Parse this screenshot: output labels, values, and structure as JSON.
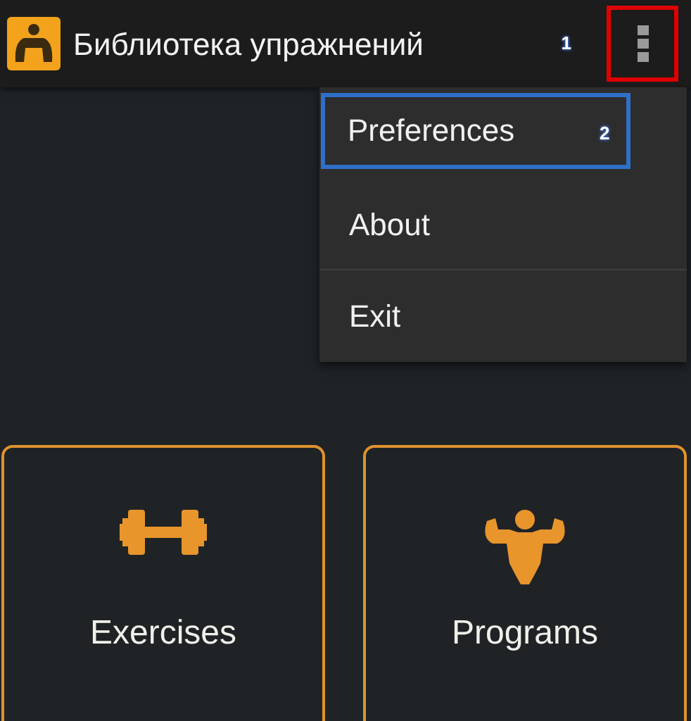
{
  "app_bar": {
    "title": "Библиотека упражнений",
    "menu_button": {
      "callout": "1",
      "highlighted": true
    }
  },
  "overflow_menu": {
    "open": true,
    "items": [
      {
        "label": "Preferences",
        "highlighted": true,
        "callout": "2"
      },
      {
        "label": "About",
        "highlighted": false
      },
      {
        "label": "Exit",
        "highlighted": false
      }
    ]
  },
  "tiles": [
    {
      "label": "Exercises",
      "kind": "dumbbell"
    },
    {
      "label": "Programs",
      "kind": "muscle"
    }
  ]
}
